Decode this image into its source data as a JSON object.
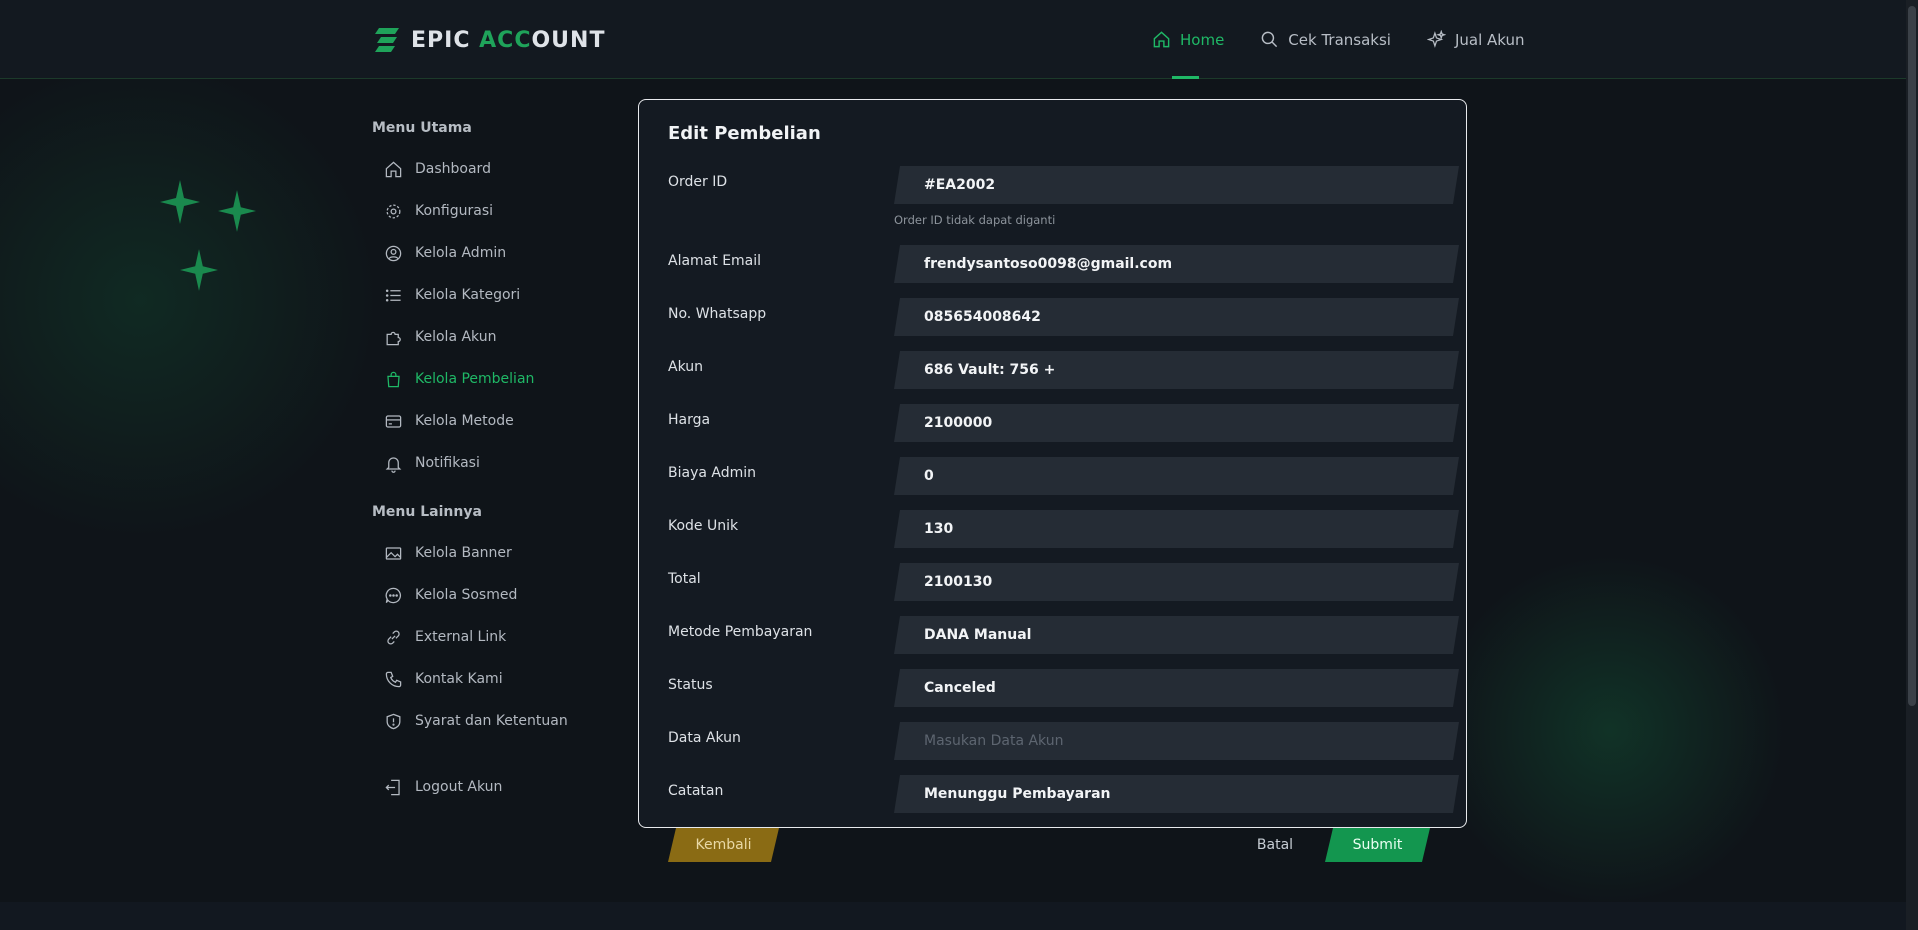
{
  "brand": {
    "name_part1": "EPIC ",
    "name_accent": "ACC",
    "name_part2": "OUNT",
    "accent_color": "#1fa35a"
  },
  "nav": [
    {
      "label": "Home",
      "icon": "home-icon",
      "active": true
    },
    {
      "label": "Cek Transaksi",
      "icon": "search-icon",
      "active": false
    },
    {
      "label": "Jual Akun",
      "icon": "sparkle-icon",
      "active": false
    }
  ],
  "sidebar": {
    "main_heading": "Menu Utama",
    "main_items": [
      {
        "label": "Dashboard",
        "icon": "home-icon"
      },
      {
        "label": "Konfigurasi",
        "icon": "gear-icon"
      },
      {
        "label": "Kelola Admin",
        "icon": "user-circle-icon"
      },
      {
        "label": "Kelola Kategori",
        "icon": "list-icon"
      },
      {
        "label": "Kelola Akun",
        "icon": "puzzle-icon"
      },
      {
        "label": "Kelola Pembelian",
        "icon": "shopping-bag-icon",
        "active": true
      },
      {
        "label": "Kelola Metode",
        "icon": "credit-card-icon"
      },
      {
        "label": "Notifikasi",
        "icon": "bell-icon"
      }
    ],
    "other_heading": "Menu Lainnya",
    "other_items": [
      {
        "label": "Kelola Banner",
        "icon": "image-icon"
      },
      {
        "label": "Kelola Sosmed",
        "icon": "chat-icon"
      },
      {
        "label": "External Link",
        "icon": "link-icon"
      },
      {
        "label": "Kontak Kami",
        "icon": "phone-icon"
      },
      {
        "label": "Syarat dan Ketentuan",
        "icon": "shield-icon"
      }
    ],
    "logout_label": "Logout Akun"
  },
  "modal": {
    "title": "Edit Pembelian",
    "order_id_hint": "Order ID tidak dapat diganti",
    "fields": [
      {
        "label": "Order ID",
        "value": "#EA2002"
      },
      {
        "label": "Alamat Email",
        "value": "frendysantoso0098@gmail.com"
      },
      {
        "label": "No. Whatsapp",
        "value": "085654008642"
      },
      {
        "label": "Akun",
        "value": "686 Vault: 756 +"
      },
      {
        "label": "Harga",
        "value": "2100000"
      },
      {
        "label": "Biaya Admin",
        "value": "0"
      },
      {
        "label": "Kode Unik",
        "value": "130"
      },
      {
        "label": "Total",
        "value": "2100130"
      },
      {
        "label": "Metode Pembayaran",
        "value": "DANA Manual"
      },
      {
        "label": "Status",
        "value": "Canceled"
      },
      {
        "label": "Data Akun",
        "value": "",
        "placeholder": "Masukan Data Akun"
      },
      {
        "label": "Catatan",
        "value": "Menunggu Pembayaran"
      }
    ]
  },
  "buttons": {
    "back": "Kembali",
    "cancel": "Batal",
    "submit": "Submit"
  },
  "colors": {
    "background": "#0f1419",
    "accent_green": "#1fb866",
    "back_button": "#8a6b14",
    "submit_button": "#13964f"
  }
}
